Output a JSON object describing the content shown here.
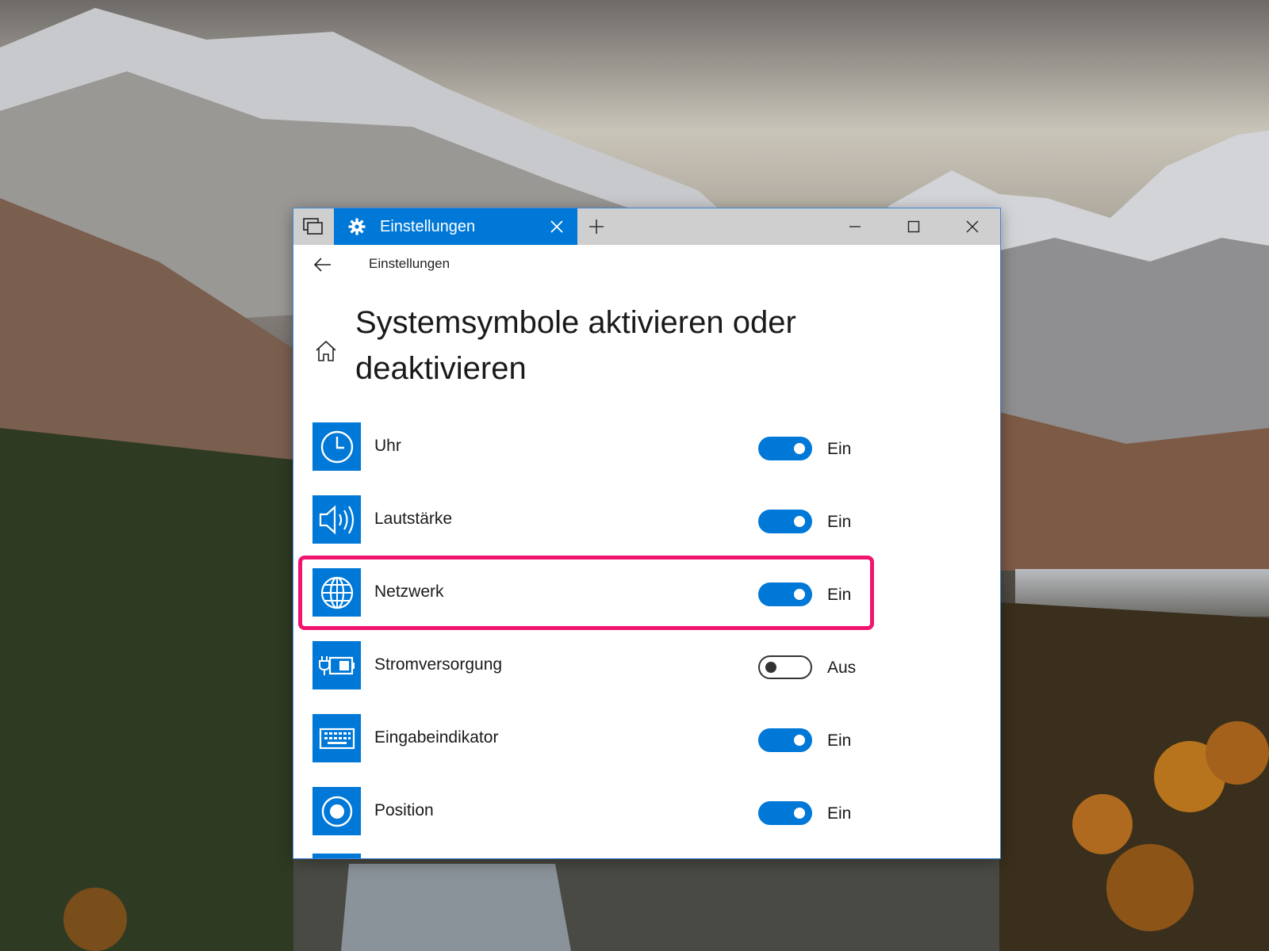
{
  "desktop": {
    "wallpaper": "mountain-lake-landscape"
  },
  "window": {
    "tab_title": "Einstellungen",
    "icons": {
      "tab_switcher": "tab-switcher-icon",
      "tab": "gear-icon",
      "tab_close": "close-icon",
      "new_tab": "plus-icon",
      "minimize": "minimize-icon",
      "maximize": "maximize-icon",
      "close": "close-icon"
    }
  },
  "header": {
    "breadcrumb": "Einstellungen",
    "back_icon": "back-arrow-icon",
    "home_icon": "home-icon"
  },
  "page": {
    "title": "Systemsymbole aktivieren oder deaktivieren"
  },
  "settings": [
    {
      "label": "Uhr",
      "icon": "clock-icon",
      "enabled": true,
      "state": "Ein"
    },
    {
      "label": "Lautstärke",
      "icon": "volume-icon",
      "enabled": true,
      "state": "Ein"
    },
    {
      "label": "Netzwerk",
      "icon": "globe-icon",
      "enabled": true,
      "state": "Ein",
      "highlighted": true
    },
    {
      "label": "Stromversorgung",
      "icon": "battery-plug-icon",
      "enabled": false,
      "state": "Aus"
    },
    {
      "label": "Eingabeindikator",
      "icon": "keyboard-icon",
      "enabled": true,
      "state": "Ein"
    },
    {
      "label": "Position",
      "icon": "location-icon",
      "enabled": true,
      "state": "Ein"
    }
  ],
  "colors": {
    "accent": "#0078d7",
    "highlight_border": "#f0166f",
    "titlebar": "#cfcfcf"
  }
}
